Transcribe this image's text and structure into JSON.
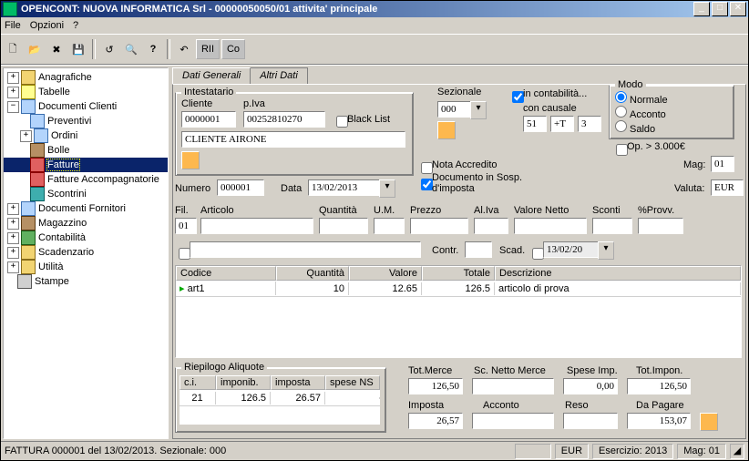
{
  "title": "OPENCONT: NUOVA INFORMATICA Srl - 00000050050/01 attivita' principale",
  "menu": {
    "file": "File",
    "opzioni": "Opzioni",
    "help": "?"
  },
  "toolbar": [
    "new",
    "open",
    "delete",
    "save",
    "refresh",
    "search",
    "help",
    "undo",
    "rec",
    "co"
  ],
  "tree": {
    "anagrafiche": "Anagrafiche",
    "tabelle": "Tabelle",
    "documenti_clienti": "Documenti Clienti",
    "preventivi": "Preventivi",
    "ordini": "Ordini",
    "bolle": "Bolle",
    "fatture": "Fatture",
    "fatture_accomp": "Fatture Accompagnatorie",
    "scontrini": "Scontrini",
    "documenti_fornitori": "Documenti Fornitori",
    "magazzino": "Magazzino",
    "contabilita": "Contabilità",
    "scadenzario": "Scadenzario",
    "utilita": "Utilità",
    "stampe": "Stampe"
  },
  "tabs": {
    "dati_generali": "Dati Generali",
    "altri_dati": "Altri Dati"
  },
  "intestatario": {
    "legend": "Intestatario",
    "cliente_label": "Cliente",
    "piva_label": "p.Iva",
    "cliente": "0000001",
    "piva": "00252810270",
    "blacklist": "Black List",
    "nome": "CLIENTE AIRONE"
  },
  "doc": {
    "numero_label": "Numero",
    "numero": "000001",
    "data_label": "Data",
    "data": "13/02/2013"
  },
  "sezionale": {
    "label": "Sezionale",
    "value": "000"
  },
  "flags": {
    "in_contabilita": "in contabilità...",
    "con_causale": "con causale",
    "con_causale_val": [
      "51",
      "+T",
      "3"
    ],
    "nota_accredito": "Nota Accredito",
    "doc_sosp": "Documento in Sosp. d'imposta"
  },
  "modo": {
    "legend": "Modo",
    "normale": "Normale",
    "acconto": "Acconto",
    "saldo": "Saldo",
    "op3000": "Op. > 3.000€"
  },
  "mag": {
    "label": "Mag:",
    "value": "01"
  },
  "valuta": {
    "label": "Valuta:",
    "value": "EUR"
  },
  "linehdr": {
    "fil": "Fil.",
    "articolo": "Articolo",
    "quantita": "Quantità",
    "um": "U.M.",
    "prezzo": "Prezzo",
    "aliva": "Al.Iva",
    "valore_netto": "Valore Netto",
    "sconti": "Sconti",
    "provv": "%Provv."
  },
  "linevals": {
    "fil": "01",
    "articolo": "",
    "quantita": "",
    "um": "",
    "prezzo": "",
    "aliva": "",
    "valore_netto": "",
    "sconti": "",
    "provv": ""
  },
  "line2": {
    "contr": "Contr.",
    "scad": "Scad.",
    "scad_val": "13/02/20"
  },
  "grid": {
    "headers": {
      "codice": "Codice",
      "quantita": "Quantità",
      "valore": "Valore",
      "totale": "Totale",
      "descrizione": "Descrizione"
    },
    "rows": [
      {
        "codice": "art1",
        "quantita": "10",
        "valore": "12.65",
        "totale": "126.5",
        "descrizione": "articolo di prova"
      }
    ]
  },
  "aliquote": {
    "legend": "Riepilogo Aliquote",
    "headers": {
      "ci": "c.i.",
      "imponib": "imponib.",
      "imposta": "imposta",
      "spese": "spese NS"
    },
    "rows": [
      {
        "ci": "21",
        "imponib": "126.5",
        "imposta": "26.57",
        "spese": ""
      }
    ]
  },
  "totali": {
    "tot_merce_label": "Tot.Merce",
    "tot_merce": "126,50",
    "sc_netto_label": "Sc. Netto Merce",
    "sc_netto": "",
    "spese_imp_label": "Spese Imp.",
    "spese_imp": "0,00",
    "tot_impon_label": "Tot.Impon.",
    "tot_impon": "126,50",
    "imposta_label": "Imposta",
    "imposta": "26,57",
    "acconto_label": "Acconto",
    "acconto": "",
    "reso_label": "Reso",
    "reso": "",
    "da_pagare_label": "Da Pagare",
    "da_pagare": "153,07"
  },
  "status": {
    "main": "FATTURA 000001 del 13/02/2013. Sezionale: 000",
    "eur": "EUR",
    "esercizio": "Esercizio: 2013",
    "mag": "Mag: 01"
  }
}
